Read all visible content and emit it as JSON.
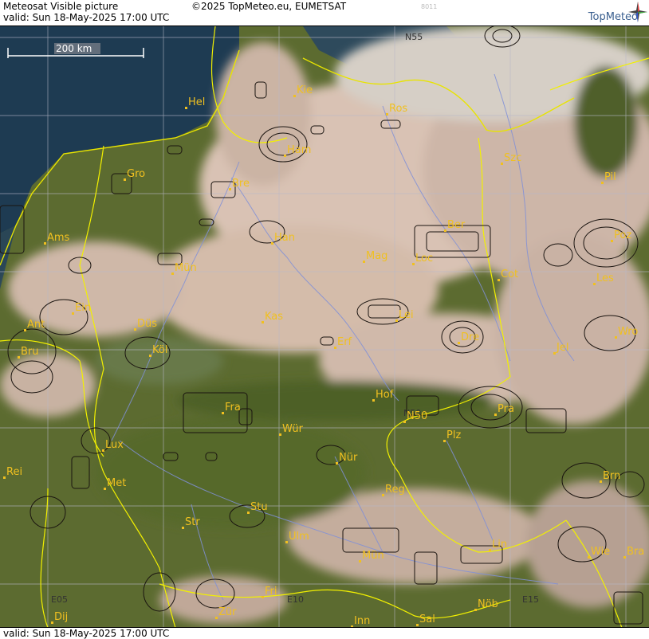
{
  "header": {
    "title": "Meteosat Visible picture",
    "valid": "valid:  Sun  18-May-2025  17:00 UTC",
    "copyright": "©2025 TopMeteo.eu, EUMETSAT",
    "code": "8011",
    "logo": "TopMeteo"
  },
  "footer": {
    "valid": "valid:  Sun  18-May-2025  17:00 UTC"
  },
  "scale": {
    "label": "200 km"
  },
  "grid_labels": [
    "N55",
    "N50",
    "E05",
    "E10",
    "E15"
  ],
  "cities": [
    "Hel",
    "Kie",
    "Ros",
    "Ham",
    "Szc",
    "Gro",
    "Bre",
    "Pil",
    "Ber",
    "Ams",
    "Han",
    "Poz",
    "Mag",
    "Loc",
    "Mün",
    "Cot",
    "Les",
    "Ein",
    "Lei",
    "Kas",
    "Ant",
    "Düs",
    "Dre",
    "Wro",
    "Bru",
    "Köl",
    "Erf",
    "Jel",
    "Hof",
    "Fra",
    "Pra",
    "N50",
    "Plz",
    "Lux",
    "Wür",
    "Nür",
    "Rei",
    "Met",
    "Brn",
    "Reg",
    "Stu",
    "Str",
    "Ulm",
    "Lin",
    "Wie",
    "Bra",
    "Mün",
    "Fri",
    "Zür",
    "Inn",
    "Sal",
    "Nöb",
    "Dij"
  ],
  "colors": {
    "sea": "#1d3a52",
    "land": "#5a6a2e",
    "cloud": "#d7c0b0",
    "city": "#f0c020",
    "border": "#f2f200",
    "river": "#7f8fd0"
  }
}
